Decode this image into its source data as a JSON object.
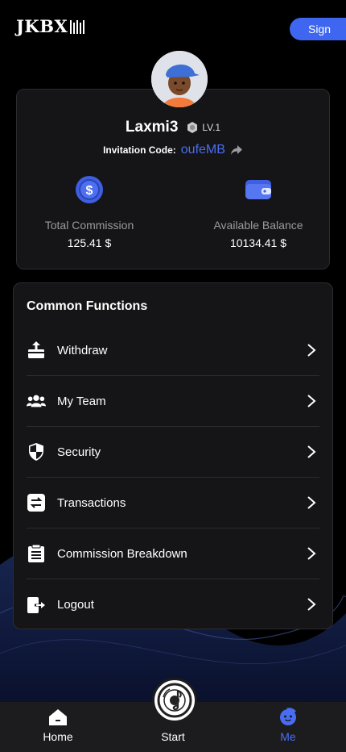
{
  "header": {
    "logo_text": "JKBX",
    "sign_label": "Sign"
  },
  "profile": {
    "username": "Laxmi3",
    "level": "LV.1",
    "invitation_label": "Invitation Code:",
    "invitation_code": "oufeMB",
    "stats": [
      {
        "label": "Total Commission",
        "value": "125.41 $",
        "icon": "dollar-coin-icon"
      },
      {
        "label": "Available Balance",
        "value": "10134.41 $",
        "icon": "wallet-icon"
      }
    ]
  },
  "functions": {
    "title": "Common Functions",
    "items": [
      {
        "label": "Withdraw",
        "icon": "withdraw-icon"
      },
      {
        "label": "My Team",
        "icon": "team-icon"
      },
      {
        "label": "Security",
        "icon": "shield-icon"
      },
      {
        "label": "Transactions",
        "icon": "transfer-arrows-icon"
      },
      {
        "label": "Commission Breakdown",
        "icon": "clipboard-list-icon"
      },
      {
        "label": "Logout",
        "icon": "logout-icon"
      }
    ]
  },
  "nav": {
    "items": [
      {
        "label": "Home",
        "icon": "home-icon"
      },
      {
        "label": "Start",
        "icon": "music-disc-icon"
      },
      {
        "label": "Me",
        "icon": "user-face-icon",
        "active": true
      }
    ]
  },
  "colors": {
    "accent": "#4a6cf2",
    "button": "#3f66f0",
    "card": "#151517",
    "nav": "#1c1c1e"
  }
}
